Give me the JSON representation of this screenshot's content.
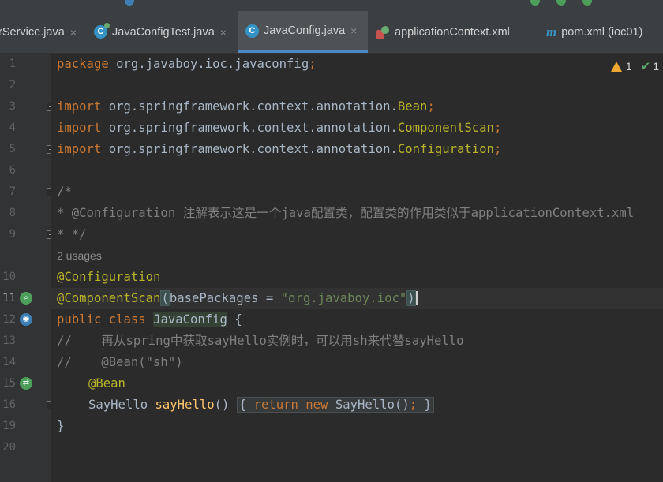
{
  "tabs": [
    {
      "label": "rService.java",
      "icon": "java-class-icon",
      "active": false
    },
    {
      "label": "JavaConfigTest.java",
      "icon": "java-test-class-icon",
      "active": false
    },
    {
      "label": "JavaConfig.java",
      "icon": "java-class-icon",
      "active": true
    },
    {
      "label": "applicationContext.xml",
      "icon": "spring-xml-icon",
      "active": false
    },
    {
      "label": "pom.xml (ioc01)",
      "icon": "maven-icon",
      "active": false
    }
  ],
  "tab_close_glyph": "×",
  "inspections": {
    "warnings": "1",
    "passed": "1"
  },
  "code": {
    "line_numbers": [
      "1",
      "2",
      "3",
      "4",
      "5",
      "6",
      "7",
      "8",
      "9",
      "10",
      "11",
      "12",
      "13",
      "14",
      "15",
      "16",
      "19",
      "20"
    ],
    "current_line": "11",
    "package_kw": "package",
    "package_name": " org.javaboy.ioc.javaconfig",
    "semicolon": ";",
    "import_kw": "import",
    "import_prefix": " org.springframework.context.annotation.",
    "imports": [
      "Bean",
      "ComponentScan",
      "Configuration"
    ],
    "doc_open": "/*",
    "doc_body": "* @Configuration 注解表示这是一个java配置类，配置类的作用类似于applicationContext.xml",
    "doc_close": "* */",
    "usages": "2 usages",
    "annotation_configuration": "@Configuration",
    "annotation_scan": "@ComponentScan",
    "scan_open": "(",
    "scan_arg": "basePackages = ",
    "scan_value": "\"org.javaboy.ioc\"",
    "scan_close": ")",
    "class_decl": "public class ",
    "class_name": "JavaConfig",
    "class_open": " {",
    "comment1": "//    再从spring中获取sayHello实例时，可以用sh来代替sayHello",
    "comment2": "//    @Bean(\"sh\")",
    "annotation_bean": "@Bean",
    "method_type": "SayHello ",
    "method_name": "sayHello",
    "method_parens": "() ",
    "method_body_open": "{ ",
    "method_return": "return new ",
    "method_new_type": "SayHello()",
    "method_body_close": " }",
    "class_close": "}"
  },
  "colors": {
    "keyword": "#cc7832",
    "annotation": "#bbb529",
    "string": "#6a8759",
    "comment": "#808080",
    "method": "#ffc66d",
    "text": "#a9b7c6",
    "accent": "#4a88c7"
  }
}
